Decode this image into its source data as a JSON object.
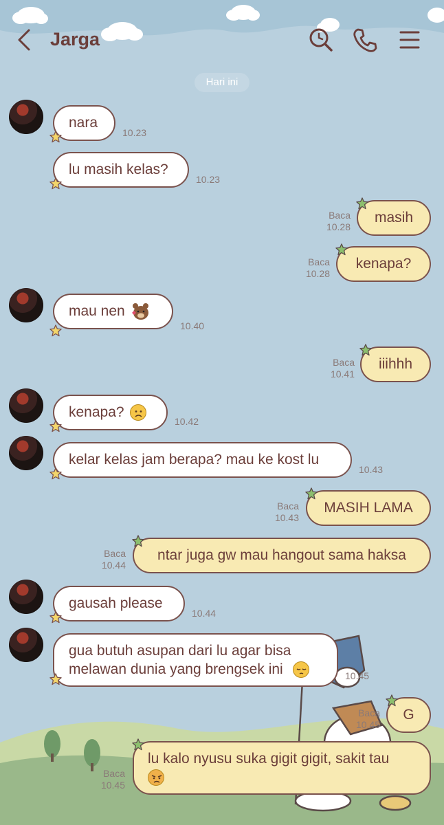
{
  "header": {
    "title": "Jarga",
    "back_icon": "chevron-left-icon",
    "search_icon": "search-clock-icon",
    "call_icon": "phone-icon",
    "menu_icon": "hamburger-menu-icon"
  },
  "date_separator": "Hari ini",
  "read_label": "Baca",
  "colors": {
    "incoming_bubble": "#ffffff",
    "outgoing_bubble": "#f8eab3",
    "bubble_border": "#7a524d",
    "text": "#6b3e3a",
    "sky": "#b9d0de",
    "grass": "#9ab88a"
  },
  "messages": [
    {
      "id": "m1",
      "dir": "in",
      "text": "nara",
      "time": "10.23"
    },
    {
      "id": "m2",
      "dir": "in",
      "text": "lu masih kelas?",
      "time": "10.23"
    },
    {
      "id": "m3",
      "dir": "out",
      "text": "masih",
      "time": "10.28",
      "read": "Baca"
    },
    {
      "id": "m4",
      "dir": "out",
      "text": "kenapa?",
      "time": "10.28",
      "read": "Baca"
    },
    {
      "id": "m5",
      "dir": "in",
      "text": "mau nen",
      "emoji": "bear-kiss-icon",
      "time": "10.40"
    },
    {
      "id": "m6",
      "dir": "out",
      "text": "iiihhh",
      "time": "10.41",
      "read": "Baca"
    },
    {
      "id": "m7",
      "dir": "in",
      "text": "kenapa?",
      "emoji": "frowning-face-icon",
      "time": "10.42"
    },
    {
      "id": "m8",
      "dir": "in",
      "text": "kelar kelas jam berapa? mau ke kost lu",
      "time": "10.43"
    },
    {
      "id": "m9",
      "dir": "out",
      "text": "MASIH LAMA",
      "time": "10.43",
      "read": "Baca"
    },
    {
      "id": "m10",
      "dir": "out",
      "text": "ntar juga gw mau hangout sama haksa",
      "time": "10.44",
      "read": "Baca"
    },
    {
      "id": "m11",
      "dir": "in",
      "text": "gausah please",
      "time": "10.44"
    },
    {
      "id": "m12",
      "dir": "in",
      "line1": "gua butuh asupan dari lu agar bisa",
      "line2": "melawan dunia yang brengsek ini",
      "emoji": "pensive-face-icon",
      "time": "10.45"
    },
    {
      "id": "m13",
      "dir": "out",
      "text": "G",
      "time": "10.45",
      "read": "Baca"
    },
    {
      "id": "m14",
      "dir": "out",
      "line1": "lu kalo nyusu suka gigit gigit, sakit tau",
      "emoji": "angry-face-icon",
      "time": "10.45",
      "read": "Baca"
    }
  ]
}
